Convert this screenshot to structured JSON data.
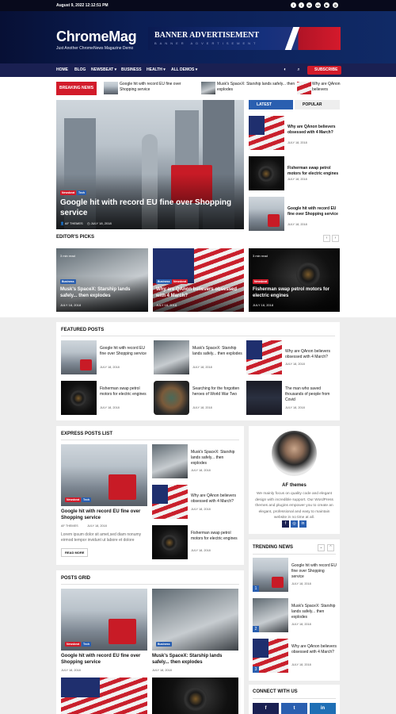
{
  "topbar": {
    "date": "August 9, 2022 12:12:51 PM"
  },
  "header": {
    "logo": "ChromeMag",
    "tagline": "Just Another ChromeNews Magazine Demo",
    "banner_title": "BANNER ADVERTISEMENT",
    "banner_sub": "BANNER ADVERTISEMENT"
  },
  "nav": {
    "items": [
      "HOME",
      "BLOG",
      "NEWSBEAT ▾",
      "BUSINESS",
      "HEALTH ▾",
      "ALL DEMOS ▾"
    ],
    "subscribe": "SUBSCRIBE"
  },
  "breaking": {
    "label": "BREAKING NEWS",
    "items": [
      "Google hit with record EU fine over Shopping service",
      "Musk's SpaceX: Starship lands safely... then explodes",
      "Why are QAnon believers obsessed with 4 March?"
    ]
  },
  "hero": {
    "badges": [
      "Newsbeat",
      "Tech"
    ],
    "title": "Google hit with record EU fine over Shopping service",
    "author": "AF THEMES",
    "date": "JULY 18, 2018"
  },
  "sidebar_tabs": {
    "latest": "LATEST",
    "popular": "POPULAR",
    "items": [
      {
        "title": "Why are QAnon believers obsessed with 4 March?",
        "date": "JULY 18, 2018"
      },
      {
        "title": "Fisherman swap petrol motors for electric engines",
        "date": "JULY 18, 2018"
      },
      {
        "title": "Google hit with record EU fine over Shopping service",
        "date": "JULY 18, 2018"
      }
    ]
  },
  "editors_picks": {
    "heading": "EDITOR'S PICKS",
    "read_time": "3 min read",
    "items": [
      {
        "badge": "Business",
        "title": "Musk's SpaceX: Starship lands safely... then explodes",
        "date": "JULY 18, 2018"
      },
      {
        "badge": "Business",
        "badge2": "Newsbeat",
        "title": "Why are QAnon believers obsessed with 4 March?",
        "date": "JULY 18, 2018"
      },
      {
        "badge": "Newsbeat",
        "title": "Fisherman swap petrol motors for electric engines",
        "date": "JULY 18, 2018"
      }
    ]
  },
  "featured": {
    "heading": "FEATURED POSTS",
    "items": [
      {
        "title": "Google hit with record EU fine over Shopping service",
        "date": "JULY 18, 2018"
      },
      {
        "title": "Musk's SpaceX: Starship lands safely... then explodes",
        "date": "JULY 18, 2018"
      },
      {
        "title": "Why are QAnon believers obsessed with 4 March?",
        "date": "JULY 18, 2018"
      },
      {
        "title": "Fisherman swap petrol motors for electric engines",
        "date": "JULY 18, 2018"
      },
      {
        "title": "Searching for the forgotten heroes of World War Two",
        "date": "JULY 18, 2018"
      },
      {
        "title": "The man who saved thousands of people from Covid",
        "date": "JULY 18, 2018"
      }
    ]
  },
  "express": {
    "heading": "EXPRESS POSTS LIST",
    "main": {
      "badges": [
        "Newsbeat",
        "Tech"
      ],
      "title": "Google hit with record EU fine over Shopping service",
      "author": "AF THEMES",
      "date": "JULY 18, 2018",
      "excerpt": "Lorem ipsum dolor sit amet,sed diam nonumy eirmod tempor invidunt ut labore et dolore",
      "read_more": "READ MORE"
    },
    "items": [
      {
        "title": "Musk's SpaceX: Starship lands safely... then explodes",
        "date": "JULY 18, 2018"
      },
      {
        "title": "Why are QAnon believers obsessed with 4 March?",
        "date": "JULY 18, 2018"
      },
      {
        "title": "Fisherman swap petrol motors for electric engines",
        "date": "JULY 18, 2018"
      }
    ]
  },
  "author": {
    "name": "AF themes",
    "bio": "We mainly focus on quality code and elegant design with incredible support. Our WordPress themes and plugins empower you to create an elegant, professional and easy to maintain website in no time at all."
  },
  "trending": {
    "heading": "TRENDING NEWS",
    "items": [
      {
        "num": "1",
        "title": "Google hit with record EU fine over Shopping service",
        "date": "JULY 18, 2018"
      },
      {
        "num": "2",
        "title": "Musk's SpaceX: Starship lands safely... then explodes",
        "date": "JULY 18, 2018"
      },
      {
        "num": "3",
        "title": "Why are QAnon believers obsessed with 4 March?",
        "date": "JULY 18, 2018"
      }
    ]
  },
  "grid": {
    "heading": "POSTS GRID",
    "items": [
      {
        "badges": [
          "Newsbeat",
          "Tech"
        ],
        "title": "Google hit with record EU fine over Shopping service",
        "date": "JULY 18, 2018"
      },
      {
        "badges": [
          "Business"
        ],
        "title": "Musk's SpaceX: Starship lands safely... then explodes",
        "date": "JULY 18, 2018"
      }
    ]
  },
  "connect": {
    "heading": "CONNECT WITH US"
  },
  "colors": {
    "accent_red": "#d21b2a",
    "accent_blue": "#2a5fb0",
    "nav": "#1a2052"
  }
}
